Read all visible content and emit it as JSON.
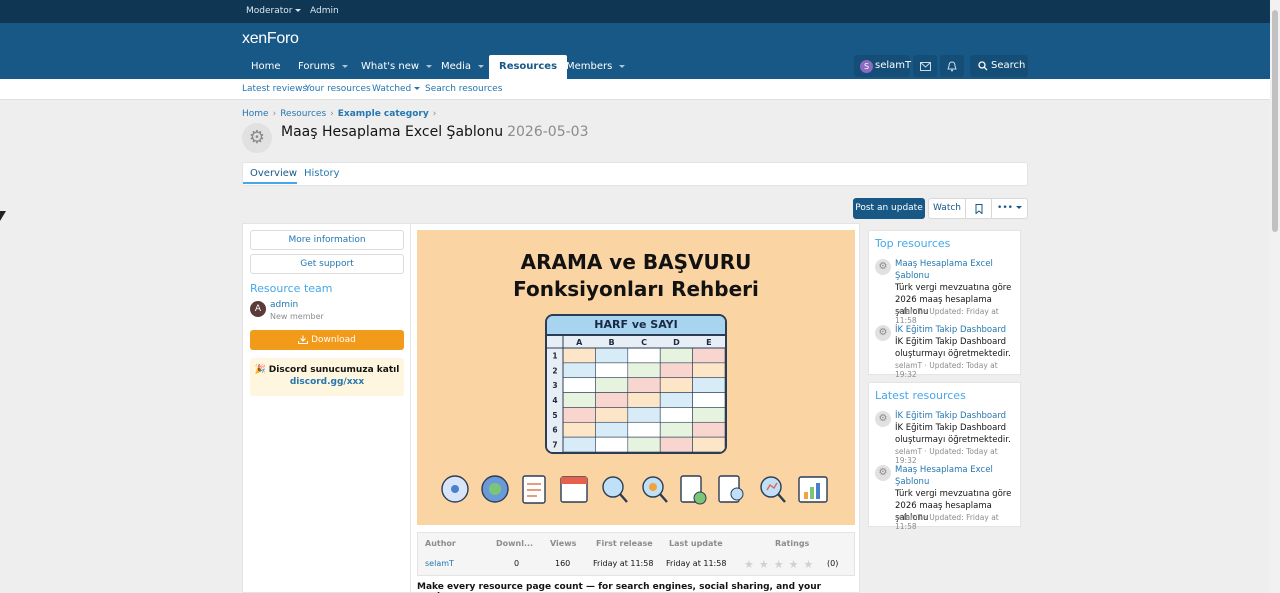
{
  "staff_bar": {
    "moderator": "Moderator",
    "admin": "Admin"
  },
  "header": {
    "logo_a": "xen",
    "logo_b": "Foro",
    "nav": [
      {
        "label": "Home"
      },
      {
        "label": "Forums"
      },
      {
        "label": "What's new"
      },
      {
        "label": "Media"
      },
      {
        "label": "Resources"
      },
      {
        "label": "Members"
      }
    ],
    "user": "selamT",
    "user_initial": "S",
    "search": "Search"
  },
  "subnav": [
    "Latest reviews",
    "Your resources",
    "Watched",
    "Search resources"
  ],
  "breadcrumb": [
    "Home",
    "Resources",
    "Example category"
  ],
  "title": {
    "text": "Maaş Hesaplama Excel Şablonu",
    "version": "2026-05-03"
  },
  "tabs": [
    "Overview",
    "History"
  ],
  "actions": {
    "post_update": "Post an update",
    "watch": "Watch",
    "more": "•••"
  },
  "sidebar": {
    "more_info": "More information",
    "get_support": "Get support",
    "team_heading": "Resource team",
    "member_name": "admin",
    "member_initial": "A",
    "member_role": "New member",
    "download": "Download",
    "discord_text": "Discord sunucumuza katıl",
    "discord_link": "discord.gg/xxx"
  },
  "banner": {
    "line1": "ARAMA ve BAŞVURU",
    "line2": "Fonksiyonları Rehberi",
    "card_title": "HARF ve SAYI",
    "columns": [
      "A",
      "B",
      "C",
      "D",
      "E"
    ],
    "rows": [
      "1",
      "2",
      "3",
      "4",
      "5",
      "6",
      "7"
    ]
  },
  "stats": {
    "headers": [
      "Author",
      "Downl...",
      "Views",
      "First release",
      "Last update",
      "Ratings"
    ],
    "values": [
      "selamT",
      "0",
      "160",
      "Friday at 11:58",
      "Friday at 11:58",
      "(0)"
    ],
    "rating": 0,
    "rating_max": 5
  },
  "tagline": "Make every resource page count — for search engines, social sharing, and your readers.",
  "top_resources": {
    "heading": "Top resources",
    "items": [
      {
        "title": "Maaş Hesaplama Excel Şablonu",
        "desc": "Türk vergi mevzuatına göre 2026 maaş hesaplama şablonu",
        "meta": "selamT · Updated: Friday at 11:58"
      },
      {
        "title": "İK Eğitim Takip Dashboard",
        "desc": "İK Eğitim Takip Dashboard oluşturmayı öğretmektedir.",
        "meta": "selamT · Updated: Today at 19:32"
      }
    ]
  },
  "latest_resources": {
    "heading": "Latest resources",
    "items": [
      {
        "title": "İK Eğitim Takip Dashboard",
        "desc": "İK Eğitim Takip Dashboard oluşturmayı öğretmektedir.",
        "meta": "selamT · Updated: Today at 19:32"
      },
      {
        "title": "Maaş Hesaplama Excel Şablonu",
        "desc": "Türk vergi mevzuatına göre 2026 maaş hesaplama şablonu",
        "meta": "selamT · Updated: Friday at 11:58"
      }
    ]
  },
  "colors": {
    "header": "#185886",
    "staff_bar": "#0f3652",
    "accent": "#47a7eb",
    "download": "#f29a1a",
    "banner": "#fbd4a4"
  }
}
